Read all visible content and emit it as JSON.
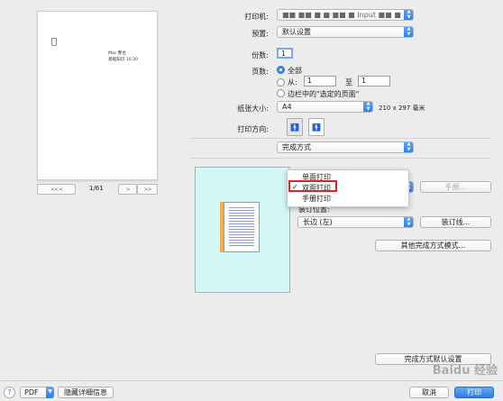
{
  "preview": {
    "logo_icon": "apple-logo-icon",
    "doc_lines": [
      "Mac 整合",
      "基础知识 10.30"
    ],
    "first_label": "<<  <",
    "page_indicator": "1/61",
    "next_label": ">",
    "last_label": ">>"
  },
  "printer": {
    "label": "打印机:",
    "value": "■■ ■■ ■ ■·■■ ■ Input ■■ ■ ■inter"
  },
  "presets": {
    "label": "预置:",
    "value": "默认设置"
  },
  "copies": {
    "label": "份数:",
    "value": "1"
  },
  "pages": {
    "label": "页数:",
    "all": "全部",
    "from": "从:",
    "from_value": "1",
    "to": "至",
    "to_value": "1",
    "selection": "边栏中的\"选定的页面\""
  },
  "paper": {
    "label": "纸张大小:",
    "value": "A4",
    "dims": "210 x 297 毫米"
  },
  "orientation": {
    "label": "打印方向:"
  },
  "section": {
    "value": "完成方式"
  },
  "duplex_menu": {
    "items": [
      "单面打印",
      "双面打印",
      "手册打印"
    ],
    "selected": "双面打印",
    "check": "✓"
  },
  "finishing": {
    "manual_button": "手册...",
    "binding_label": "装订位置:",
    "binding_value": "长边 (左)",
    "gutter_button": "装订线...",
    "other_button": "其他完成方式模式...",
    "default_button": "完成方式默认设置"
  },
  "footer": {
    "help": "?",
    "pdf": "PDF",
    "hide_details": "隐藏详细信息",
    "cancel": "取消",
    "print": "打印"
  },
  "watermark": "Baidu 经验",
  "colors": {
    "accent": "#2c7cf0",
    "highlight": "#e02424",
    "thumb_bg": "#d3f7f7",
    "binding": "#f3b042"
  }
}
